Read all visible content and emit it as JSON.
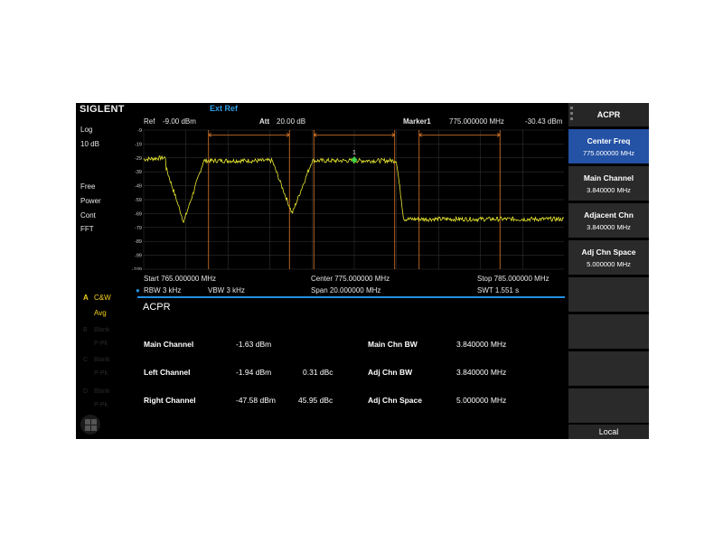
{
  "brand": "SIGLENT",
  "status": {
    "ext_ref": "Ext Ref"
  },
  "header": {
    "ref_label": "Ref",
    "ref_value": "-9.00 dBm",
    "att_label": "Att",
    "att_value": "20.00 dB",
    "marker_label": "Marker1",
    "marker_freq": "775.000000 MHz",
    "marker_level": "-30.43 dBm"
  },
  "left_panel": {
    "scale_type": "Log",
    "scale_div": "10 dB",
    "trigger": "Free",
    "detector": "Power",
    "sweep_mode": "Cont",
    "sweep_type": "FFT",
    "trace_a_letter": "A",
    "trace_a_mode": "C&W",
    "trace_a_detect": "Avg",
    "trace_b_letter": "B",
    "trace_b_mode": "Blank",
    "trace_b_detect": "P-Pk",
    "trace_c_letter": "C",
    "trace_c_mode": "Blank",
    "trace_c_detect": "P-Pk",
    "trace_d_letter": "D",
    "trace_d_mode": "Blank",
    "trace_d_detect": "P-Pk"
  },
  "plot": {
    "y_ticks": [
      "-9",
      "-19",
      "-29",
      "-39",
      "-49",
      "-59",
      "-69",
      "-79",
      "-89",
      "-99",
      "-109"
    ],
    "marker_number": "1",
    "trace_color": "#e8e830",
    "line_color": "#e07a2a",
    "marker_color": "#3fd04a"
  },
  "footer": {
    "start": "Start  765.000000 MHz",
    "center": "Center  775.000000 MHz",
    "stop": "Stop  785.000000 MHz",
    "rbw": "RBW  3 kHz",
    "vbw": "VBW  3 kHz",
    "span": "Span   20.000000 MHz",
    "swt": "SWT  1.551 s"
  },
  "acpr": {
    "title": "ACPR",
    "rows": [
      {
        "label": "Main Channel",
        "power": "-1.63 dBm",
        "rel": "",
        "param_label": "Main Chn BW",
        "param_value": "3.840000 MHz"
      },
      {
        "label": "Left Channel",
        "power": "-1.94 dBm",
        "rel": "0.31 dBc",
        "param_label": "Adj Chn BW",
        "param_value": "3.840000 MHz"
      },
      {
        "label": "Right Channel",
        "power": "-47.58 dBm",
        "rel": "45.95 dBc",
        "param_label": "Adj Chn Space",
        "param_value": "5.000000 MHz"
      }
    ]
  },
  "menu": {
    "title": "ACPR",
    "items": [
      {
        "label": "Center Freq",
        "value": "775.000000 MHz"
      },
      {
        "label": "Main Channel",
        "value": "3.840000 MHz"
      },
      {
        "label": "Adjacent Chn",
        "value": "3.840000 MHz"
      },
      {
        "label": "Adj Chn Space",
        "value": "5.000000 MHz"
      }
    ],
    "local": "Local"
  }
}
